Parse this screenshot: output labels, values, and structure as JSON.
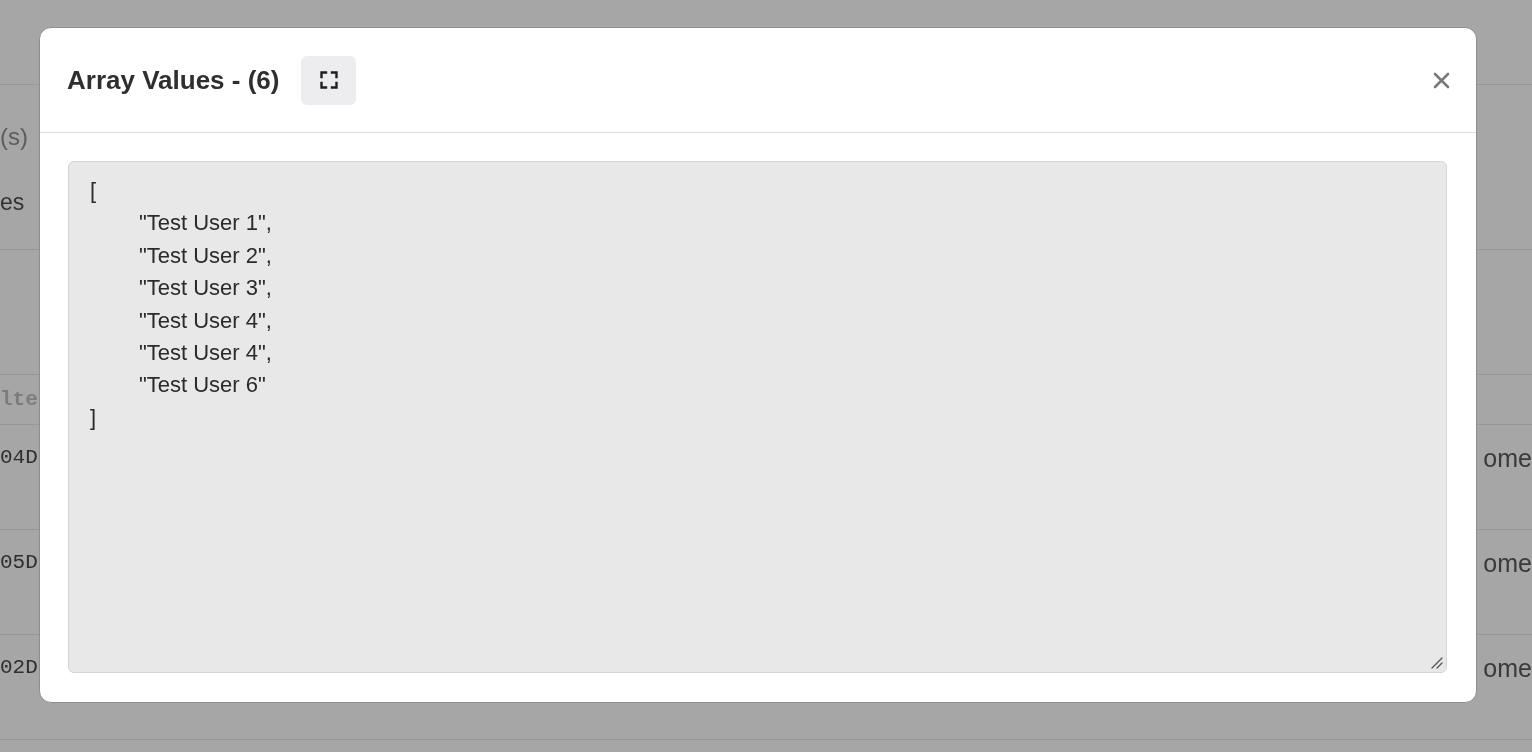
{
  "background_page": {
    "section_texts": [
      "(s)",
      "es"
    ],
    "table": {
      "column_header": "lte",
      "rows": [
        {
          "column_1": "04D",
          "column_2": "ome"
        },
        {
          "column_1": "05D",
          "column_2": "ome"
        },
        {
          "column_1": "02D",
          "column_2": "ome"
        }
      ]
    }
  },
  "dialog": {
    "title": "Array Values - (6)",
    "value": "[\n\t\"Test User 1\",\n\t\"Test User 2\",\n\t\"Test User 3\",\n\t\"Test User 4\",\n\t\"Test User 4\",\n\t\"Test User 6\"\n]"
  }
}
